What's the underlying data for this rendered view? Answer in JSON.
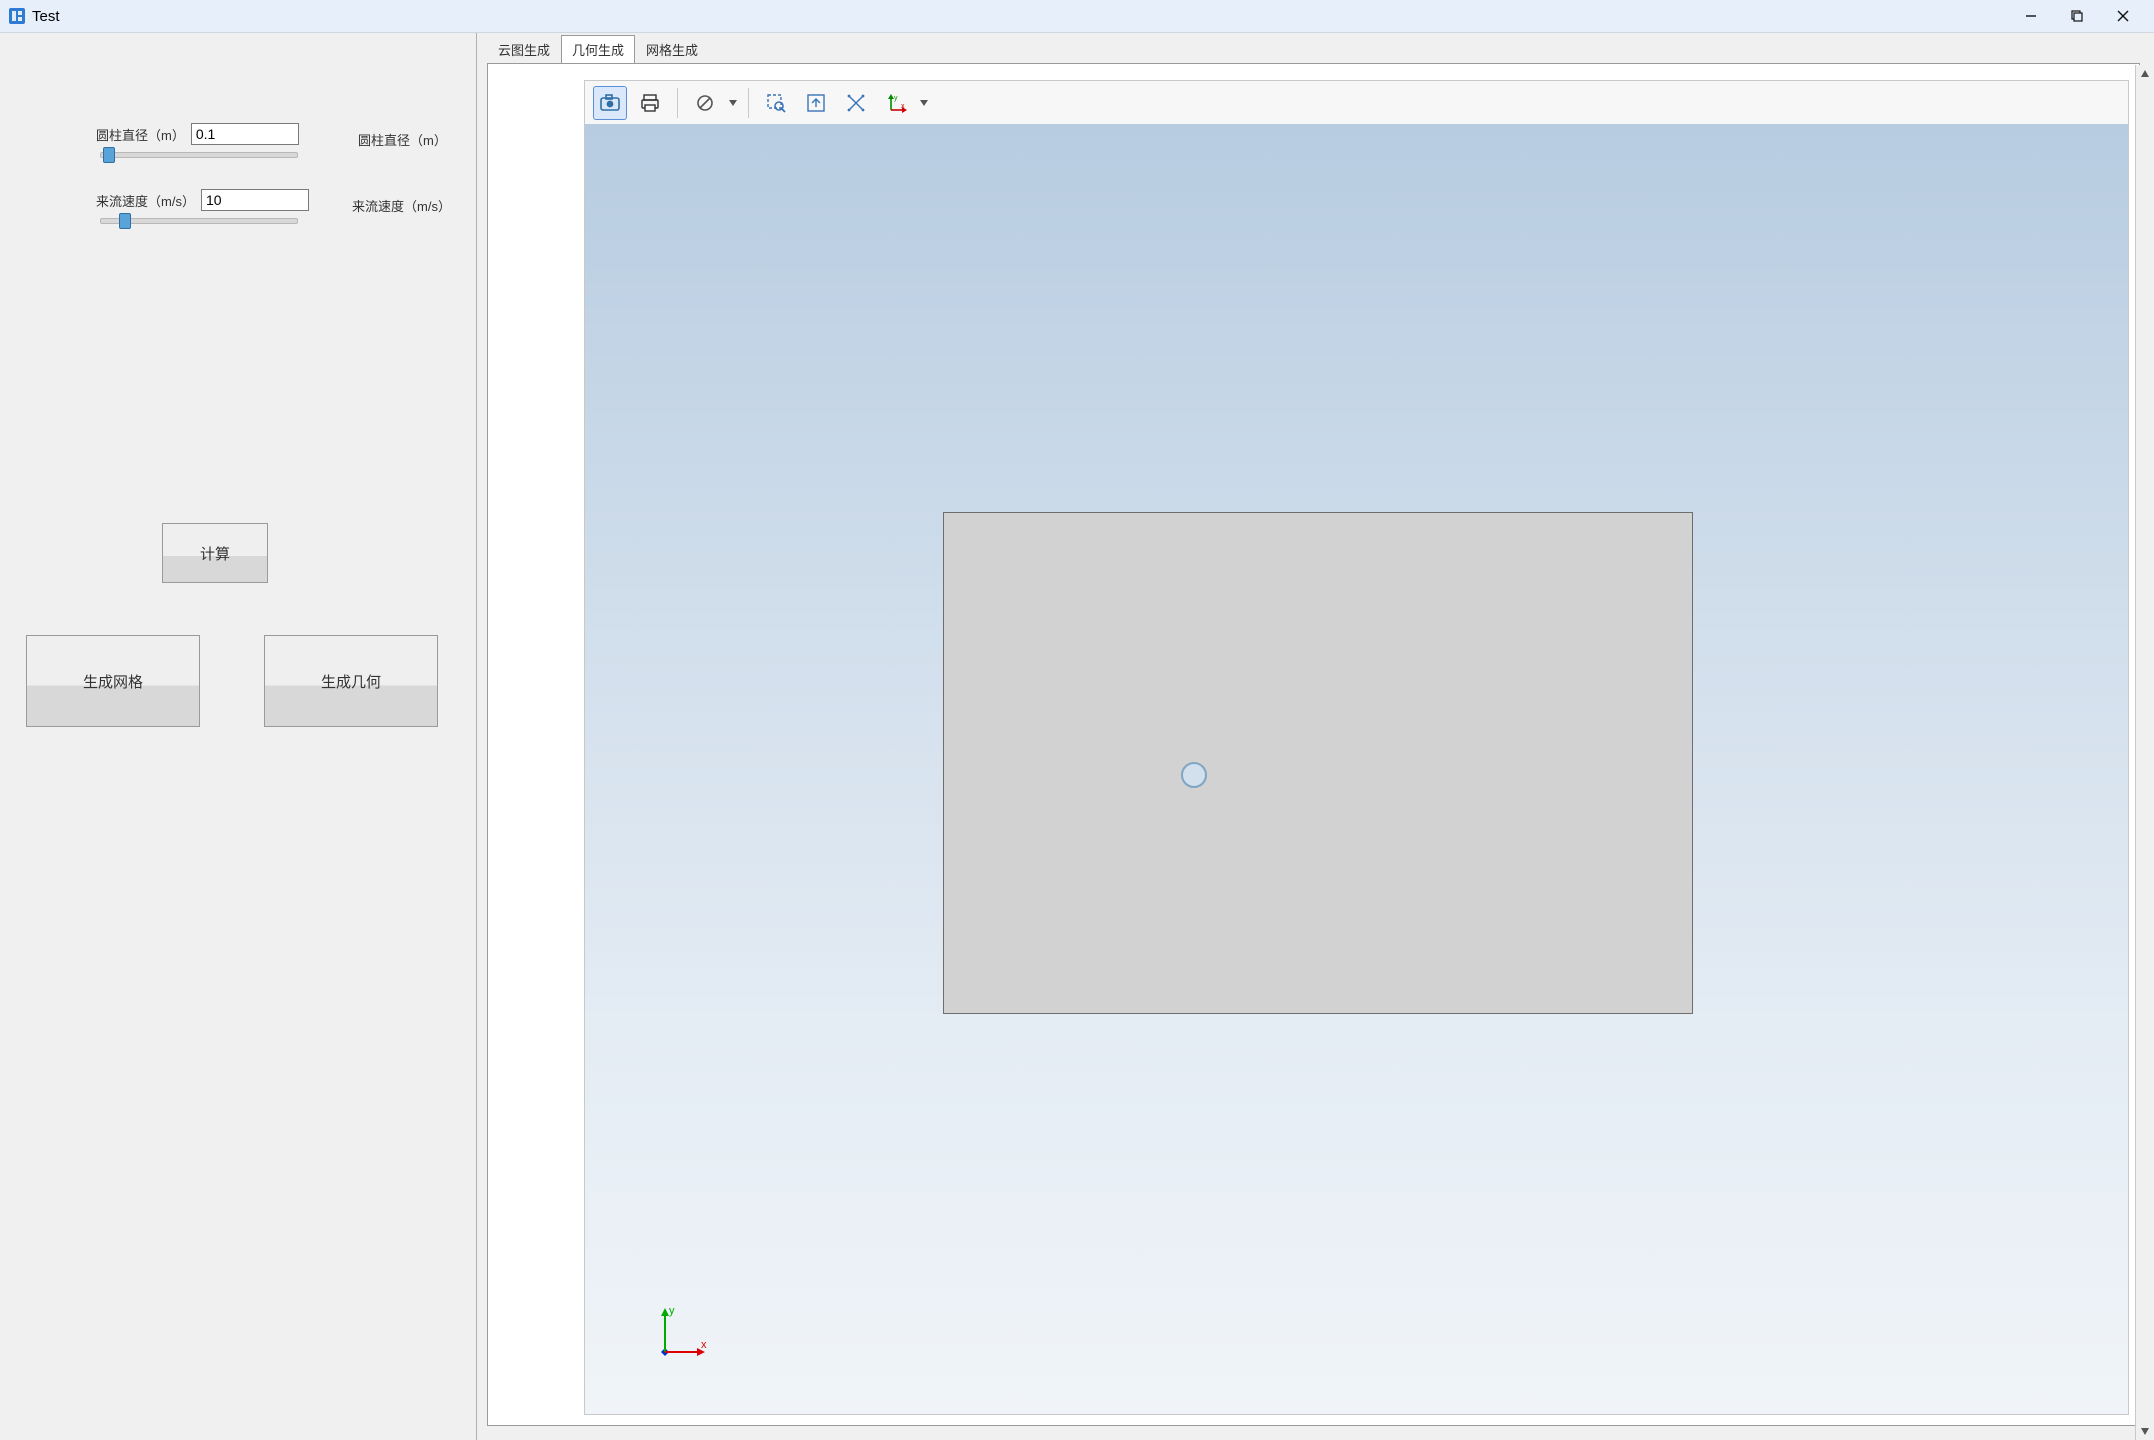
{
  "window": {
    "title": "Test"
  },
  "titlebar_buttons": {
    "minimize": "minimize",
    "maximize": "maximize",
    "close": "close"
  },
  "left_panel": {
    "diameter_label": "圆柱直径（m）",
    "diameter_value": "0.1",
    "velocity_label": "来流速度（m/s）",
    "velocity_value": "10",
    "compute_button": "计算",
    "gen_mesh_button": "生成网格",
    "gen_geometry_button": "生成几何"
  },
  "right_readout": {
    "diameter_label": "圆柱直径（m）",
    "velocity_label": "来流速度（m/s）"
  },
  "tabs": {
    "items": [
      "云图生成",
      "几何生成",
      "网格生成"
    ],
    "active_index": 1
  },
  "gfx_toolbar": {
    "camera": "camera-icon",
    "print": "print-icon",
    "nodata": "null-icon",
    "zoombox": "zoom-box-icon",
    "fit": "fit-view-icon",
    "measure": "measure-icon",
    "axes": "axes-orient-icon"
  },
  "viewport": {
    "triad_labels": {
      "x": "x",
      "y": "y"
    }
  }
}
